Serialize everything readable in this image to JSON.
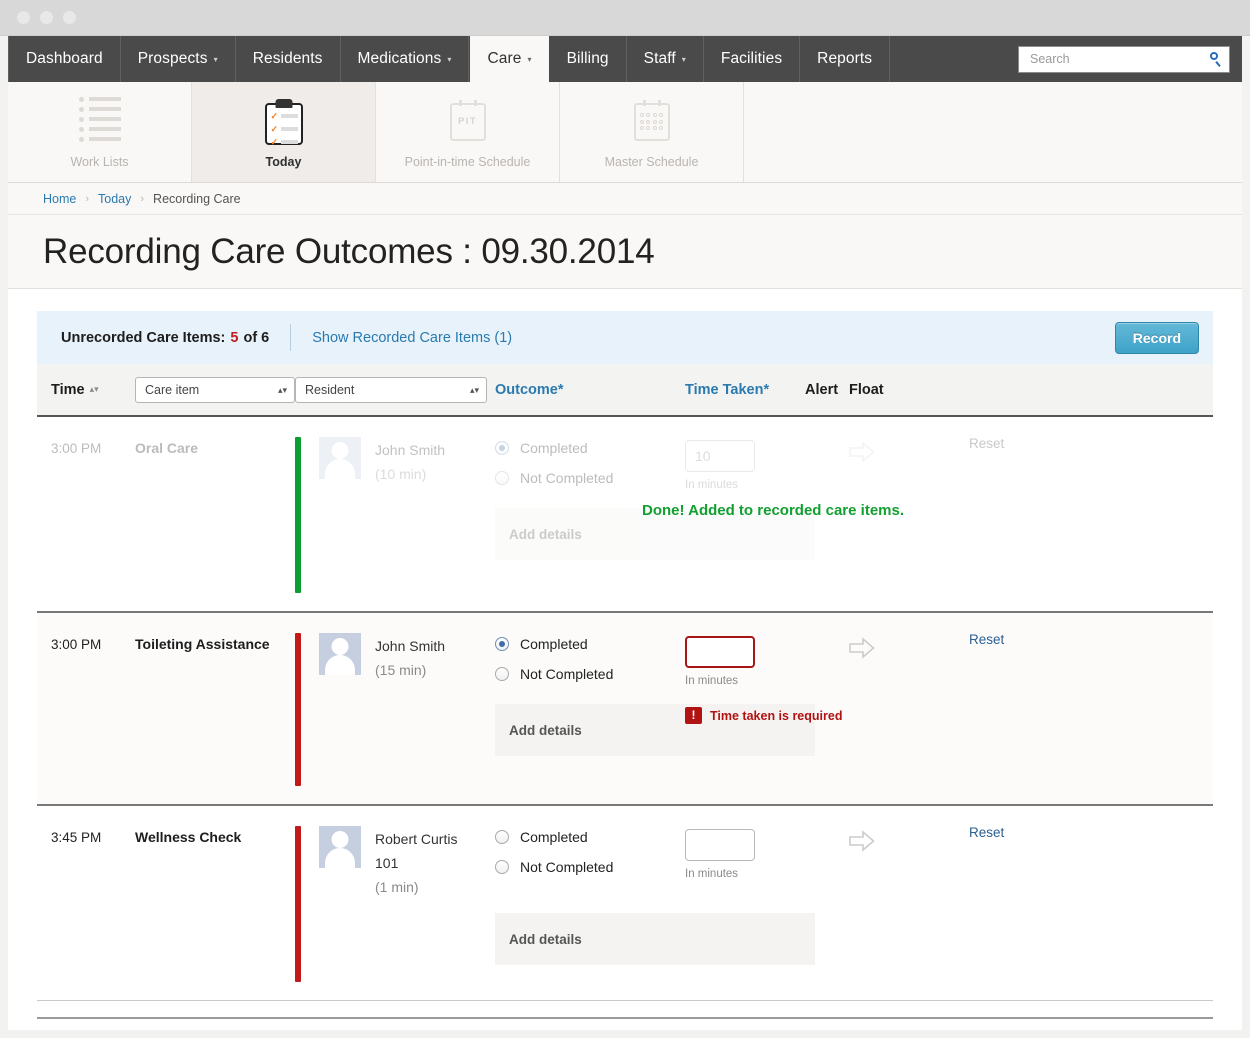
{
  "window": {
    "dots": [
      "close",
      "minimize",
      "maximize"
    ]
  },
  "mainnav": {
    "items": [
      {
        "label": "Dashboard",
        "dropdown": false,
        "active": false
      },
      {
        "label": "Prospects",
        "dropdown": true,
        "active": false
      },
      {
        "label": "Residents",
        "dropdown": false,
        "active": false
      },
      {
        "label": "Medications",
        "dropdown": true,
        "active": false
      },
      {
        "label": "Care",
        "dropdown": true,
        "active": true
      },
      {
        "label": "Billing",
        "dropdown": false,
        "active": false
      },
      {
        "label": "Staff",
        "dropdown": true,
        "active": false
      },
      {
        "label": "Facilities",
        "dropdown": false,
        "active": false
      },
      {
        "label": "Reports",
        "dropdown": false,
        "active": false
      }
    ],
    "caret": "▾",
    "search": {
      "placeholder": "Search",
      "value": "",
      "icon": "search-icon"
    }
  },
  "subnav": {
    "items": [
      {
        "label": "Work Lists",
        "icon": "work-lists-icon",
        "active": false
      },
      {
        "label": "Today",
        "icon": "clipboard-icon",
        "active": true
      },
      {
        "label": "Point-in-time Schedule",
        "icon": "pit-calendar-icon",
        "active": false,
        "icon_text": "PIT"
      },
      {
        "label": "Master Schedule",
        "icon": "master-calendar-icon",
        "active": false
      }
    ]
  },
  "breadcrumb": {
    "items": [
      "Home",
      "Today",
      "Recording Care"
    ],
    "separator": "›"
  },
  "page": {
    "title": "Recording Care Outcomes : 09.30.2014"
  },
  "infobar": {
    "unrecorded_prefix": "Unrecorded Care Items:",
    "unrecorded_count": "5",
    "unrecorded_suffix": "of 6",
    "show_recorded_link": "Show Recorded Care Items (1)",
    "record_button": "Record"
  },
  "table": {
    "headers": {
      "time": "Time",
      "sort_icon": "▴▾",
      "care_item_filter": "Care item",
      "resident_filter": "Resident",
      "outcome": "Outcome",
      "outcome_star": "*",
      "time_taken": "Time Taken",
      "time_taken_star": "*",
      "alert": "Alert",
      "float": "Float",
      "select_arrows": "▴▾"
    },
    "rows": [
      {
        "time": "3:00 PM",
        "care_item": "Oral Care",
        "status_color": "#0a9d2f",
        "resident_name": "John Smith",
        "resident_room": "",
        "duration": "(10 min)",
        "outcome_completed": "Completed",
        "outcome_not_completed": "Not Completed",
        "selected": "completed",
        "time_taken_value": "10",
        "time_taken_hint": "In minutes",
        "time_taken_error": "",
        "details_label": "Add details",
        "success_message": "Done! Added to recorded care items.",
        "reset_label": "Reset",
        "state": "recorded",
        "float_icon": "arrow-right-icon"
      },
      {
        "time": "3:00 PM",
        "care_item": "Toileting Assistance",
        "status_color": "#c21a1a",
        "resident_name": "John Smith",
        "resident_room": "",
        "duration": "(15 min)",
        "outcome_completed": "Completed",
        "outcome_not_completed": "Not Completed",
        "selected": "completed",
        "time_taken_value": "",
        "time_taken_hint": "In minutes",
        "time_taken_error": "Time taken is required",
        "error_icon": "!",
        "details_label": "Add details",
        "success_message": "",
        "reset_label": "Reset",
        "state": "error",
        "float_icon": "arrow-right-icon"
      },
      {
        "time": "3:45 PM",
        "care_item": "Wellness Check",
        "status_color": "#c21a1a",
        "resident_name": "Robert Curtis",
        "resident_room": "101",
        "duration": "(1 min)",
        "outcome_completed": "Completed",
        "outcome_not_completed": "Not Completed",
        "selected": "none",
        "time_taken_value": "",
        "time_taken_hint": "In minutes",
        "time_taken_error": "",
        "details_label": "Add details",
        "success_message": "",
        "reset_label": "Reset",
        "state": "pending",
        "float_icon": "arrow-right-icon"
      }
    ]
  },
  "colors": {
    "accent_blue": "#2a7ab0",
    "record_button": "#3fa2c9",
    "success_green": "#12a031",
    "error_red": "#b11212",
    "status_green": "#0a9d2f",
    "status_red": "#c21a1a",
    "nav_bar": "#4a4a4a",
    "info_bar": "#e8f2fa"
  }
}
